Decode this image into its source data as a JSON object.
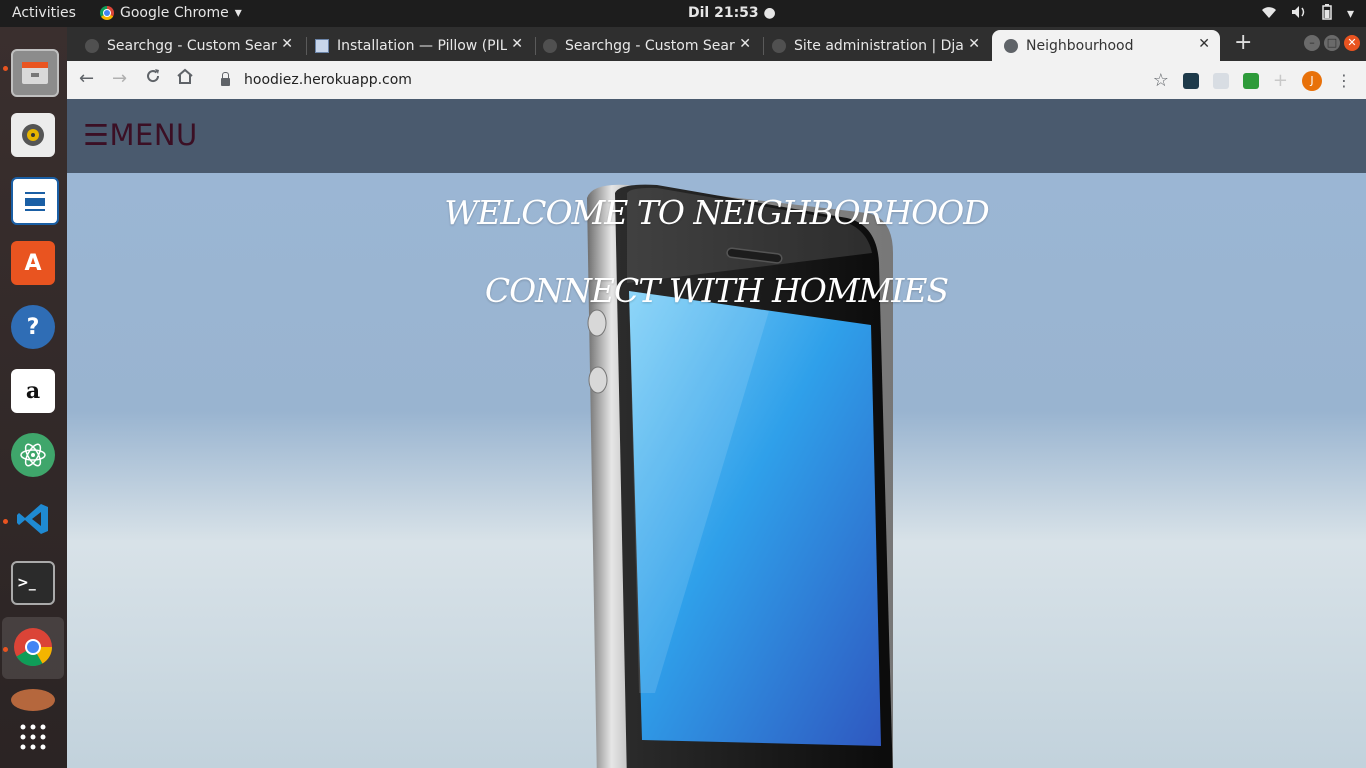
{
  "system": {
    "activities": "Activities",
    "app_name": "Google Chrome",
    "clock": "Dil 21:53"
  },
  "browser": {
    "tabs": [
      {
        "title": "Searchgg - Custom Search",
        "icon": "globe-icon",
        "active": false
      },
      {
        "title": "Installation — Pillow (PIL Fork)",
        "icon": "document-icon",
        "active": false
      },
      {
        "title": "Searchgg - Custom Search",
        "icon": "globe-icon",
        "active": false
      },
      {
        "title": "Site administration | Django",
        "icon": "globe-icon",
        "active": false
      },
      {
        "title": "Neighbourhood",
        "icon": "globe-icon",
        "active": true
      }
    ],
    "url": "hoodiez.herokuapp.com",
    "profile_initial": "J"
  },
  "page": {
    "menu_label": "☰MENU",
    "hero_line1": "WELCOME TO NEIGHBORHOOD",
    "hero_line2": "CONNECT WITH HOMMIES"
  },
  "dock_apps": [
    "files-icon",
    "speaker-icon",
    "writer-icon",
    "software-center-icon",
    "help-icon",
    "amazon-icon",
    "atom-icon",
    "vscode-icon",
    "terminal-icon",
    "chrome-icon",
    "show-apps-icon"
  ],
  "colors": {
    "navbar": "#4a5a6e",
    "menu_text": "#3b0f24",
    "hero_text": "#ffffff",
    "accent": "#e95420"
  }
}
